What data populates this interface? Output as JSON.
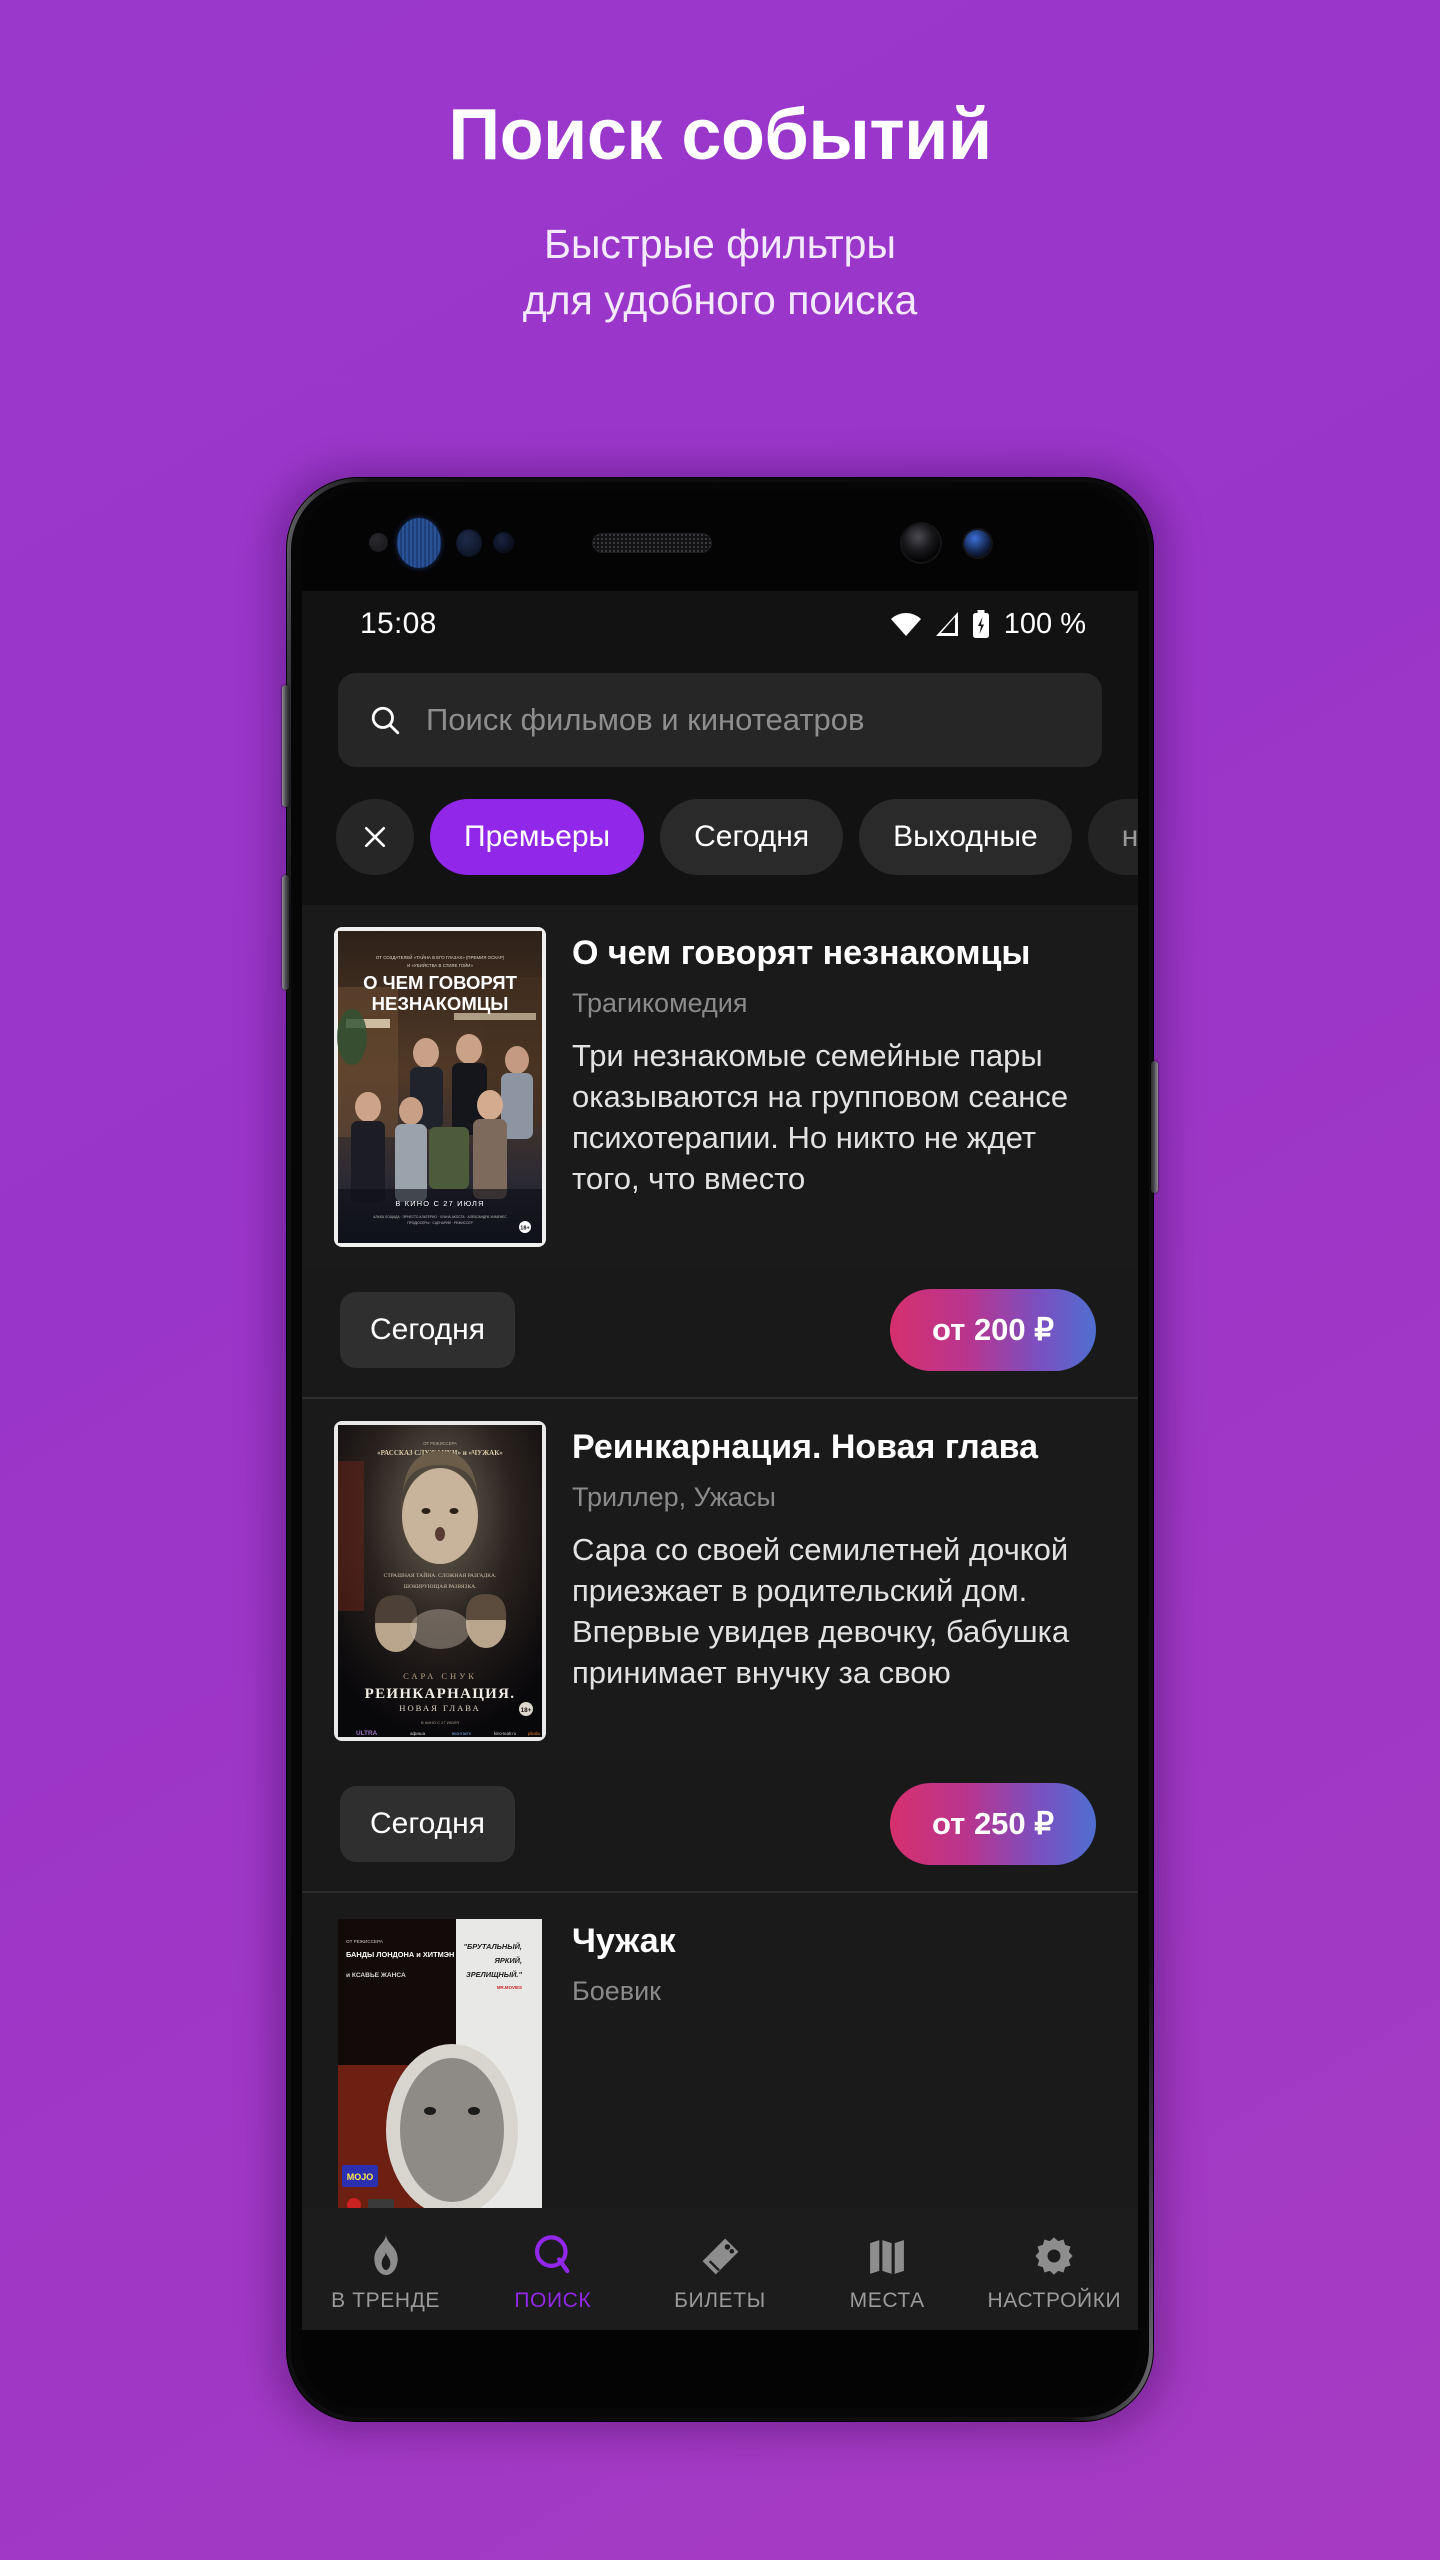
{
  "promo": {
    "title": "Поиск событий",
    "subtitle_line1": "Быстрые фильтры",
    "subtitle_line2": "для удобного поиска"
  },
  "colors": {
    "background_purple": "#9a35c8",
    "accent_purple": "#9127e8",
    "screen_bg": "#121212",
    "card_bg": "#1a1a1a",
    "price_gradient_from": "#d6306e",
    "price_gradient_to": "#4f6fd0"
  },
  "statusbar": {
    "time": "15:08",
    "battery_percent": "100 %",
    "icons": [
      "wifi-icon",
      "cellular-signal-icon",
      "battery-charging-icon"
    ]
  },
  "search": {
    "icon": "search-icon",
    "placeholder": "Поиск фильмов и кинотеатров",
    "value": ""
  },
  "filters": {
    "clear_label": "✕",
    "chips": [
      {
        "label": "Премьеры",
        "active": true
      },
      {
        "label": "Сегодня",
        "active": false
      },
      {
        "label": "Выходные",
        "active": false
      },
      {
        "label": "на я",
        "active": false
      }
    ]
  },
  "movies": [
    {
      "title": "О чем говорят незнакомцы",
      "genre": "Трагикомедия",
      "description": "Три незнакомые семейные пары оказываются на групповом сеансе психотерапии. Но никто не ждет того, что вместо",
      "day_label": "Сегодня",
      "price_label": "от 200 ₽",
      "poster_title_line1": "О ЧЕМ ГОВОРЯТ",
      "poster_title_line2": "НЕЗНАКОМЦЫ",
      "poster_release": "В КИНО С 27 ИЮЛЯ",
      "poster_age": "18+"
    },
    {
      "title": "Реинкарнация. Новая глава",
      "genre": "Триллер, Ужасы",
      "description": "Сара со своей семилетней дочкой приезжает в родительский дом. Впервые увидев девочку, бабушка принимает внучку за свою",
      "day_label": "Сегодня",
      "price_label": "от 250 ₽",
      "poster_title_line1": "РЕИНКАРНАЦИЯ.",
      "poster_title_line2": "НОВАЯ ГЛАВА",
      "poster_tagline1": "СТРАШНАЯ ТАЙНА. СЛОЖНАЯ РАЗГАДКА.",
      "poster_tagline2": "ШОКИРУЮЩАЯ РАЗВЯЗКА.",
      "poster_star": "САРА СНУК",
      "poster_release": "В КИНО С 27 ИЮЛЯ",
      "poster_age": "18+"
    },
    {
      "title": "Чужак",
      "genre": "Боевик",
      "poster_quote1": "\"БРУТАЛЬНЫЙ,",
      "poster_quote2": "ЯРКИЙ,",
      "poster_quote3": "ЗРЕЛИЩНЫЙ.\"",
      "poster_credit1": "ОТ РЕЖИССЕРА",
      "poster_credit2": "БАНДЫ ЛОНДОНА И ХИТМЭН"
    }
  ],
  "bottomnav": [
    {
      "label": "В ТРЕНДЕ",
      "icon": "flame-icon",
      "active": false
    },
    {
      "label": "ПОИСК",
      "icon": "search-icon",
      "active": true
    },
    {
      "label": "БИЛЕТЫ",
      "icon": "ticket-icon",
      "active": false
    },
    {
      "label": "МЕСТА",
      "icon": "seats-icon",
      "active": false
    },
    {
      "label": "НАСТРОЙКИ",
      "icon": "gear-icon",
      "active": false
    }
  ]
}
